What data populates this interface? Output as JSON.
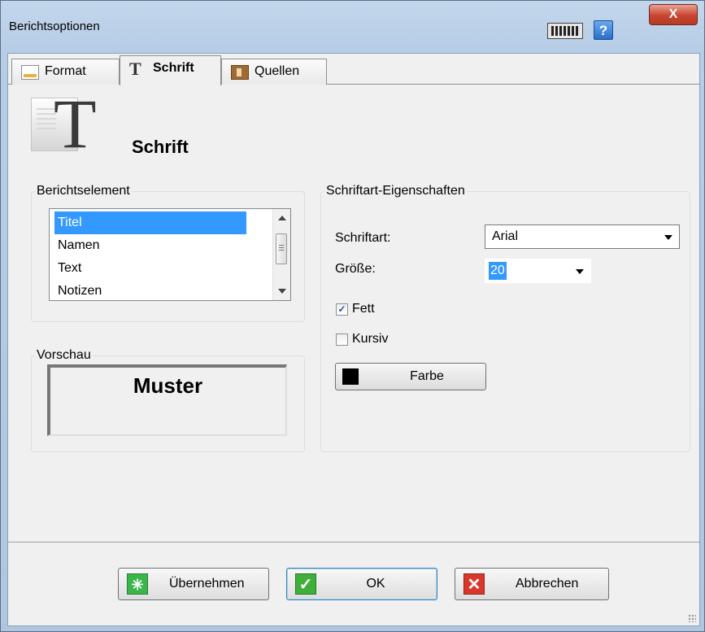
{
  "window": {
    "title": "Berichtsoptionen",
    "help_label": "?",
    "close_label": "X"
  },
  "tabs": [
    {
      "label": "Format",
      "icon": "format-icon",
      "active": false
    },
    {
      "label": "Schrift",
      "icon": "font-t-icon",
      "active": true
    },
    {
      "label": "Quellen",
      "icon": "sources-icon",
      "active": false
    }
  ],
  "header": {
    "title": "Schrift",
    "icon": "font-document-icon"
  },
  "berichtselement": {
    "legend": "Berichtselement",
    "items": [
      "Titel",
      "Namen",
      "Text",
      "Notizen"
    ],
    "selected": "Titel"
  },
  "vorschau": {
    "legend": "Vorschau",
    "sample": "Muster"
  },
  "schriftart_eigenschaften": {
    "legend": "Schriftart-Eigenschaften",
    "font_label": "Schriftart:",
    "font_value": "Arial",
    "size_label": "Größe:",
    "size_value": "20",
    "bold_label": "Fett",
    "bold_checked": true,
    "italic_label": "Kursiv",
    "italic_checked": false,
    "color_button_label": "Farbe",
    "color_value": "#000000"
  },
  "footer": {
    "apply_label": "Übernehmen",
    "ok_label": "OK",
    "cancel_label": "Abbrechen"
  },
  "colors": {
    "selection": "#3399ff",
    "apply_icon": "#3bb54a",
    "ok_icon": "#3fae3a",
    "cancel_icon": "#d9372b"
  }
}
